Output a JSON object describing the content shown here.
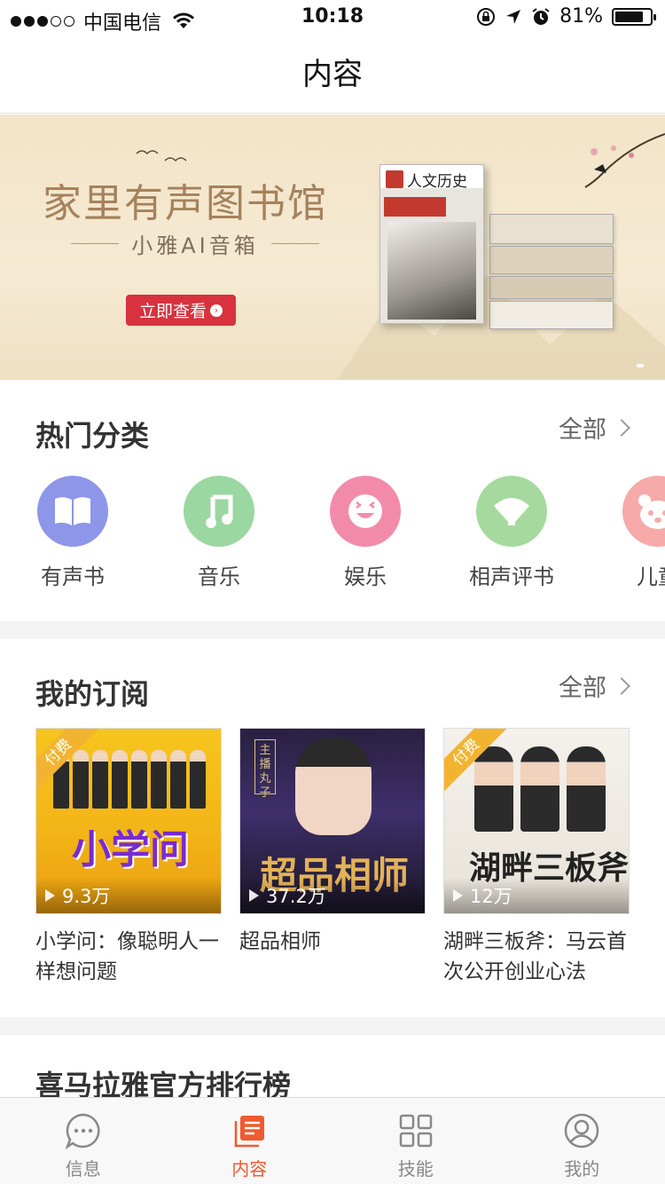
{
  "status_bar": {
    "carrier": "中国电信",
    "time": "10:18",
    "battery": "81%",
    "battery_level": 0.81
  },
  "nav": {
    "title": "内容"
  },
  "banner": {
    "title": "家里有声图书馆",
    "subtitle": "小雅AI音箱",
    "button_label": "立即查看",
    "book_title": "人文历史"
  },
  "categories_section": {
    "title": "热门分类",
    "more_label": "全部",
    "items": [
      {
        "label": "有声书",
        "icon": "book-open-icon",
        "color": "#8d96e8"
      },
      {
        "label": "音乐",
        "icon": "music-note-icon",
        "color": "#9bd7a0"
      },
      {
        "label": "娱乐",
        "icon": "smiley-icon",
        "color": "#f28ba9"
      },
      {
        "label": "相声评书",
        "icon": "fan-icon",
        "color": "#a6d99e"
      },
      {
        "label": "儿童",
        "icon": "bear-icon",
        "color": "#f6aaa9"
      }
    ]
  },
  "subscriptions_section": {
    "title": "我的订阅",
    "more_label": "全部",
    "items": [
      {
        "title": "小学问：像聪明人一样想问题",
        "plays": "9.3万",
        "badge": "付费",
        "cover_text": "小学问"
      },
      {
        "title": "超品相师",
        "plays": "37.2万",
        "badge": "",
        "cover_text": "超品相师",
        "cover_tag": "主播丸子"
      },
      {
        "title": "湖畔三板斧：马云首次公开创业心法",
        "plays": "12万",
        "badge": "付费",
        "cover_text": "湖畔三板斧"
      }
    ]
  },
  "ranking_section": {
    "title": "喜马拉雅官方排行榜"
  },
  "tab_bar": {
    "accent": "#f05a30",
    "tabs": [
      {
        "label": "信息",
        "icon": "chat-bubble-icon",
        "active": false
      },
      {
        "label": "内容",
        "icon": "content-list-icon",
        "active": true
      },
      {
        "label": "技能",
        "icon": "grid-icon",
        "active": false
      },
      {
        "label": "我的",
        "icon": "profile-icon",
        "active": false
      }
    ]
  }
}
